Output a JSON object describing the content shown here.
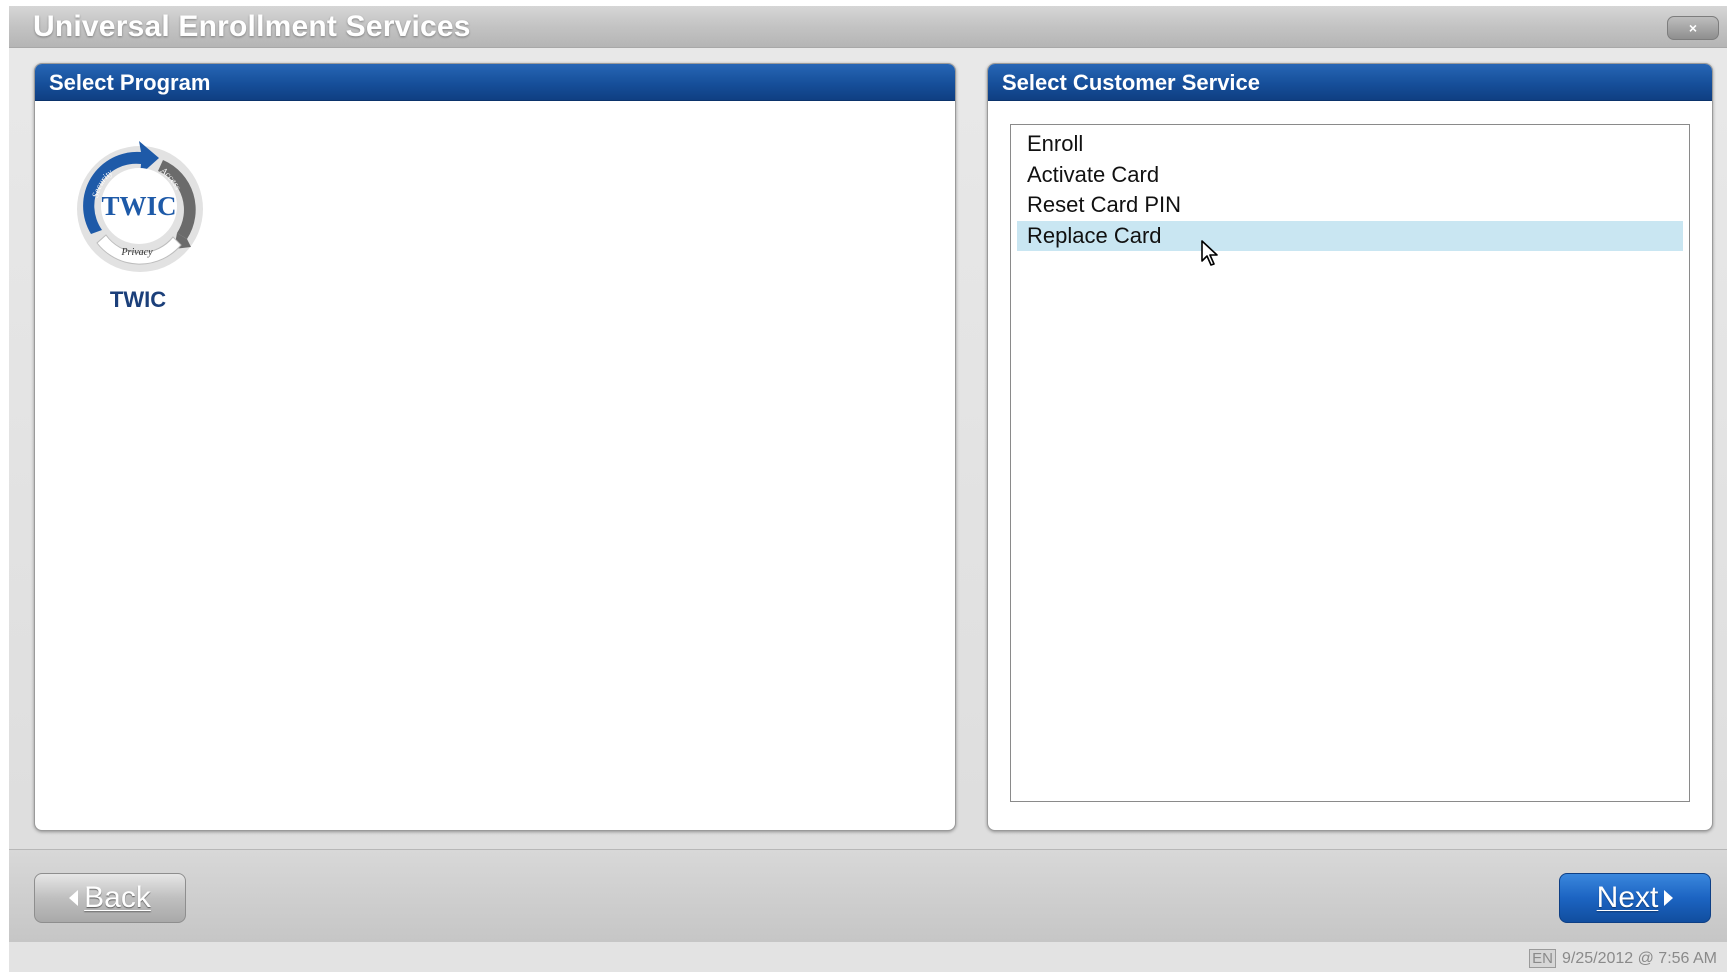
{
  "window": {
    "title": "Universal Enrollment Services",
    "close_label": "×"
  },
  "program_panel": {
    "header": "Select Program",
    "programs": [
      {
        "label": "TWIC",
        "logo_icon": "twic-logo",
        "logo_text": "TWIC",
        "logo_words": [
          "Security",
          "Access",
          "Privacy"
        ]
      }
    ]
  },
  "service_panel": {
    "header": "Select Customer Service",
    "items": [
      {
        "label": "Enroll",
        "selected": false
      },
      {
        "label": "Activate Card",
        "selected": false
      },
      {
        "label": "Reset Card PIN",
        "selected": false
      },
      {
        "label": "Replace Card",
        "selected": true
      }
    ]
  },
  "footer": {
    "back_label": "Back",
    "next_label": "Next"
  },
  "status": {
    "language": "EN",
    "datetime": "9/25/2012 @ 7:56 AM"
  },
  "colors": {
    "header_blue": "#164f9a",
    "selection": "#c9e6f2",
    "next_button": "#1c64c2",
    "program_label": "#1b3f7a"
  }
}
